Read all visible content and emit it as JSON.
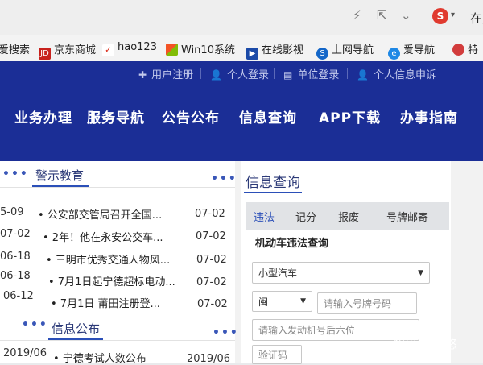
{
  "browser": {
    "title_fragment": "在此",
    "icons": [
      "lightning-icon",
      "share-icon",
      "chevron-down-icon",
      "sogou-icon"
    ]
  },
  "bookmarks": [
    {
      "label": "爱搜索",
      "icon": ""
    },
    {
      "label": "京东商城",
      "icon": "jd-icon"
    },
    {
      "label": "hao123",
      "icon": "hao123-icon"
    },
    {
      "label": "Win10系统",
      "icon": "windows-icon"
    },
    {
      "label": "在线影视",
      "icon": "film-icon"
    },
    {
      "label": "上网导航",
      "icon": "nav-icon"
    },
    {
      "label": "爱导航",
      "icon": "ie-icon"
    },
    {
      "label": "特",
      "icon": "partial-icon"
    }
  ],
  "header": {
    "util_links": [
      "用户注册",
      "个人登录",
      "单位登录",
      "个人信息申诉"
    ],
    "nav": [
      "业务办理",
      "服务导航",
      "公告公布",
      "信息查询",
      "APP下载",
      "办事指南"
    ],
    "bg_color": "#1b2e96"
  },
  "education": {
    "title": "警示教育",
    "more": "•••",
    "items": [
      {
        "left_date": "5-09",
        "title": "• 公安部交管局召开全国...",
        "date": "07-02"
      },
      {
        "left_date": "07-02",
        "title": "• 2年！他在永安公交车...",
        "date": "07-02"
      },
      {
        "left_date": "06-18",
        "title": "• 三明市优秀交通人物风...",
        "date": "07-02"
      },
      {
        "left_date": "06-18",
        "title": "• 7月1日起宁德超标电动...",
        "date": "07-02"
      },
      {
        "left_date": "06-12",
        "title": "• 7月1日 莆田注册登...",
        "date": "07-02"
      }
    ]
  },
  "notice": {
    "title": "信息公布",
    "more": "•••",
    "left_more": "•••",
    "left_more_top": "•••",
    "items": [
      {
        "left_date": "2019/06",
        "title": "• 宁德考试人数公布",
        "date": "2019/06"
      }
    ]
  },
  "query": {
    "title": "信息查询",
    "tabs": [
      "违法",
      "记分",
      "报废",
      "号牌邮寄"
    ],
    "active_tab": 0,
    "form_title": "机动车违法查询",
    "vehicle_type": "小型汽车",
    "province": "闽",
    "plate_placeholder": "请输入号牌号码",
    "engine_placeholder": "请输入发动机号后六位",
    "captcha_placeholder": "验证码"
  },
  "watermark": "知乎 @悠悠"
}
